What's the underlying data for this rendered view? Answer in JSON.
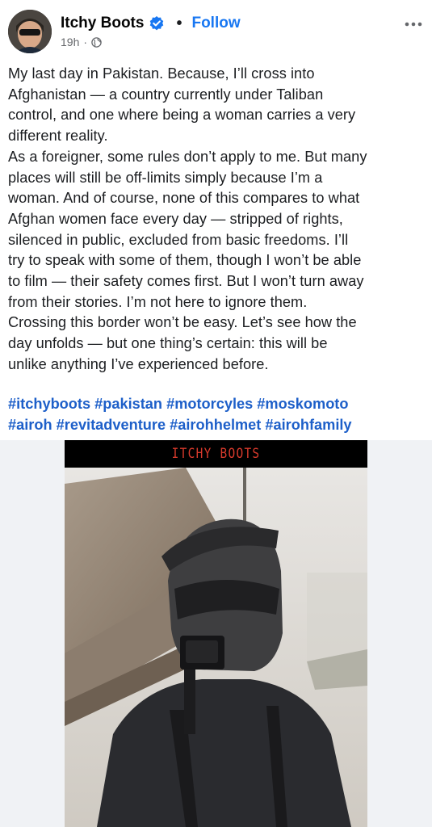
{
  "post": {
    "author": "Itchy Boots",
    "follow_label": "Follow",
    "separator": "•",
    "timestamp": "19h",
    "meta_separator": "·",
    "icons": {
      "avatar": "profile-photo",
      "verified": "verified-badge-icon",
      "audience": "globe-icon",
      "more": "more-options-icon"
    },
    "body": "My last day in Pakistan. Because, I’ll cross into\nAfghanistan — a country currently under Taliban\ncontrol, and one where being a woman carries a very\ndifferent reality.\nAs a foreigner, some rules don’t apply to me. But many\nplaces will still be off-limits simply because I’m a\nwoman. And of course, none of this compares to what\nAfghan women face every day — stripped of rights,\nsilenced in public, excluded from basic freedoms. I’ll\ntry to speak with some of them, though I won’t be able\nto film — their safety comes first. But I won’t turn away\nfrom their stories. I’m not here to ignore them.\nCrossing this border won’t be easy. Let’s see how the\nday unfolds — but one thing’s certain: this will be\nunlike anything I’ve experienced before.",
    "hashtags": "#itchyboots #pakistan #motorcyles #moskomoto\n#airoh #revitadventure #airohhelmet #airohfamily"
  },
  "media": {
    "banner_text": "ITCHY BOOTS",
    "colors": {
      "banner_text": "#d83a2c",
      "hashtag": "#1d5fc9",
      "follow": "#1877f2"
    }
  }
}
